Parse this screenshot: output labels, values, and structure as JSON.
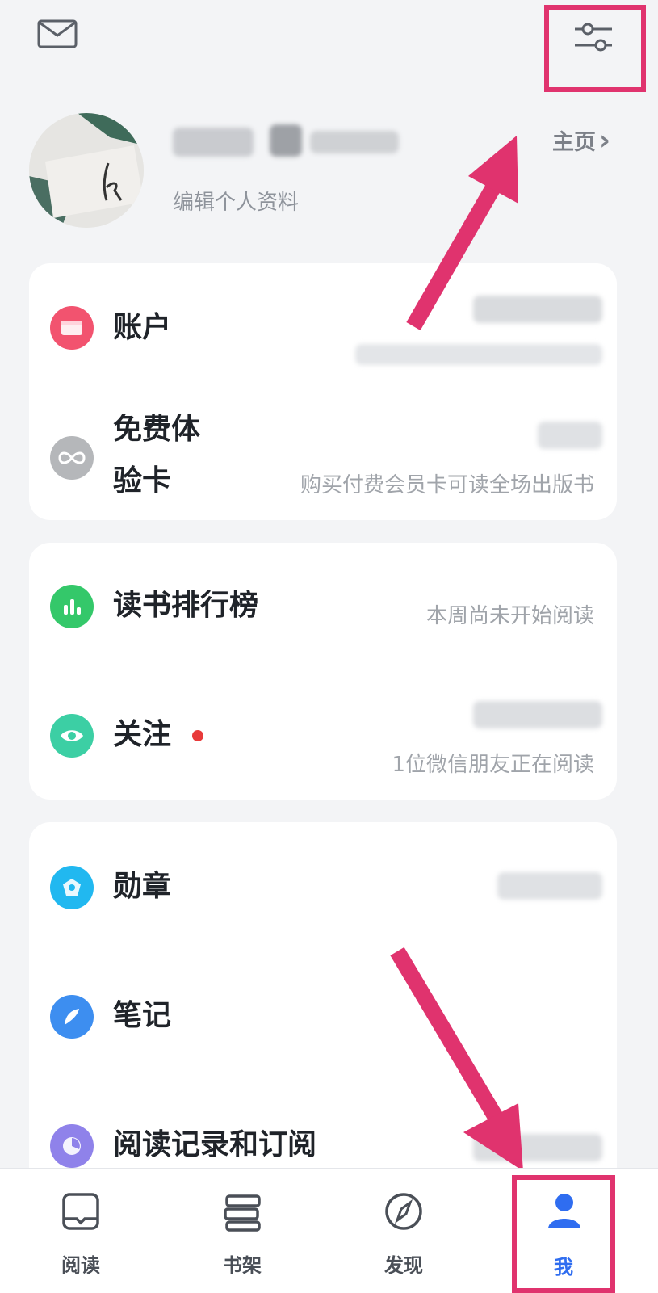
{
  "header": {
    "mail_icon": "mail-icon",
    "settings_icon": "sliders-icon"
  },
  "profile": {
    "edit_label": "编辑个人资料",
    "home_label": "主页",
    "home_chevron": "›"
  },
  "sections": {
    "account": {
      "label": "账户",
      "icon": "wallet-icon",
      "color": "#f2536f"
    },
    "trial": {
      "label_line1": "免费体",
      "label_line2": "验卡",
      "subtitle": "购买付费会员卡可读全场出版书",
      "icon": "infinity-icon",
      "color": "#b5b7ba"
    },
    "ranking": {
      "label": "读书排行榜",
      "subtitle": "本周尚未开始阅读",
      "icon": "bar-chart-icon",
      "color": "#34c86a"
    },
    "follow": {
      "label": "关注",
      "subtitle": "1位微信朋友正在阅读",
      "icon": "eye-icon",
      "color": "#3ccfa4"
    },
    "badge": {
      "label": "勋章",
      "icon": "medal-icon",
      "color": "#21b8f0"
    },
    "notes": {
      "label": "笔记",
      "icon": "feather-icon",
      "color": "#3d8ef0"
    },
    "history": {
      "label": "阅读记录和订阅",
      "icon": "clock-icon",
      "color": "#8f82ea"
    }
  },
  "tabbar": {
    "tabs": [
      {
        "label": "阅读",
        "icon": "book-icon"
      },
      {
        "label": "书架",
        "icon": "bookshelf-icon"
      },
      {
        "label": "发现",
        "icon": "compass-icon"
      },
      {
        "label": "我",
        "icon": "person-icon",
        "active": true
      }
    ],
    "active_color": "#2f6df0"
  },
  "annotation_color": "#e0336e"
}
